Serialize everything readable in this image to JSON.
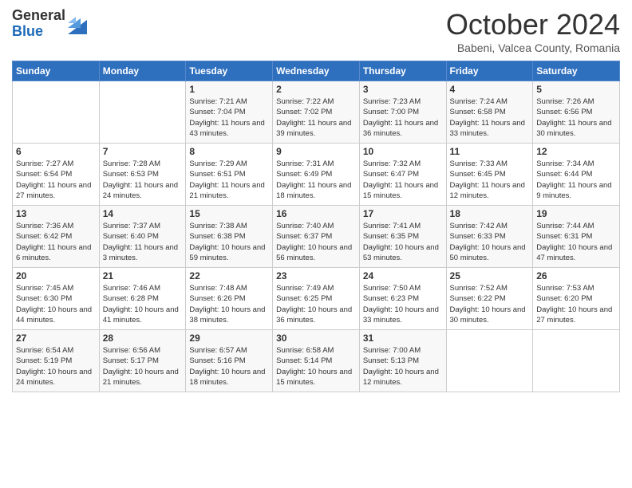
{
  "logo": {
    "general": "General",
    "blue": "Blue"
  },
  "title": "October 2024",
  "subtitle": "Babeni, Valcea County, Romania",
  "days_of_week": [
    "Sunday",
    "Monday",
    "Tuesday",
    "Wednesday",
    "Thursday",
    "Friday",
    "Saturday"
  ],
  "weeks": [
    [
      {
        "day": "",
        "info": ""
      },
      {
        "day": "",
        "info": ""
      },
      {
        "day": "1",
        "info": "Sunrise: 7:21 AM\nSunset: 7:04 PM\nDaylight: 11 hours and 43 minutes."
      },
      {
        "day": "2",
        "info": "Sunrise: 7:22 AM\nSunset: 7:02 PM\nDaylight: 11 hours and 39 minutes."
      },
      {
        "day": "3",
        "info": "Sunrise: 7:23 AM\nSunset: 7:00 PM\nDaylight: 11 hours and 36 minutes."
      },
      {
        "day": "4",
        "info": "Sunrise: 7:24 AM\nSunset: 6:58 PM\nDaylight: 11 hours and 33 minutes."
      },
      {
        "day": "5",
        "info": "Sunrise: 7:26 AM\nSunset: 6:56 PM\nDaylight: 11 hours and 30 minutes."
      }
    ],
    [
      {
        "day": "6",
        "info": "Sunrise: 7:27 AM\nSunset: 6:54 PM\nDaylight: 11 hours and 27 minutes."
      },
      {
        "day": "7",
        "info": "Sunrise: 7:28 AM\nSunset: 6:53 PM\nDaylight: 11 hours and 24 minutes."
      },
      {
        "day": "8",
        "info": "Sunrise: 7:29 AM\nSunset: 6:51 PM\nDaylight: 11 hours and 21 minutes."
      },
      {
        "day": "9",
        "info": "Sunrise: 7:31 AM\nSunset: 6:49 PM\nDaylight: 11 hours and 18 minutes."
      },
      {
        "day": "10",
        "info": "Sunrise: 7:32 AM\nSunset: 6:47 PM\nDaylight: 11 hours and 15 minutes."
      },
      {
        "day": "11",
        "info": "Sunrise: 7:33 AM\nSunset: 6:45 PM\nDaylight: 11 hours and 12 minutes."
      },
      {
        "day": "12",
        "info": "Sunrise: 7:34 AM\nSunset: 6:44 PM\nDaylight: 11 hours and 9 minutes."
      }
    ],
    [
      {
        "day": "13",
        "info": "Sunrise: 7:36 AM\nSunset: 6:42 PM\nDaylight: 11 hours and 6 minutes."
      },
      {
        "day": "14",
        "info": "Sunrise: 7:37 AM\nSunset: 6:40 PM\nDaylight: 11 hours and 3 minutes."
      },
      {
        "day": "15",
        "info": "Sunrise: 7:38 AM\nSunset: 6:38 PM\nDaylight: 10 hours and 59 minutes."
      },
      {
        "day": "16",
        "info": "Sunrise: 7:40 AM\nSunset: 6:37 PM\nDaylight: 10 hours and 56 minutes."
      },
      {
        "day": "17",
        "info": "Sunrise: 7:41 AM\nSunset: 6:35 PM\nDaylight: 10 hours and 53 minutes."
      },
      {
        "day": "18",
        "info": "Sunrise: 7:42 AM\nSunset: 6:33 PM\nDaylight: 10 hours and 50 minutes."
      },
      {
        "day": "19",
        "info": "Sunrise: 7:44 AM\nSunset: 6:31 PM\nDaylight: 10 hours and 47 minutes."
      }
    ],
    [
      {
        "day": "20",
        "info": "Sunrise: 7:45 AM\nSunset: 6:30 PM\nDaylight: 10 hours and 44 minutes."
      },
      {
        "day": "21",
        "info": "Sunrise: 7:46 AM\nSunset: 6:28 PM\nDaylight: 10 hours and 41 minutes."
      },
      {
        "day": "22",
        "info": "Sunrise: 7:48 AM\nSunset: 6:26 PM\nDaylight: 10 hours and 38 minutes."
      },
      {
        "day": "23",
        "info": "Sunrise: 7:49 AM\nSunset: 6:25 PM\nDaylight: 10 hours and 36 minutes."
      },
      {
        "day": "24",
        "info": "Sunrise: 7:50 AM\nSunset: 6:23 PM\nDaylight: 10 hours and 33 minutes."
      },
      {
        "day": "25",
        "info": "Sunrise: 7:52 AM\nSunset: 6:22 PM\nDaylight: 10 hours and 30 minutes."
      },
      {
        "day": "26",
        "info": "Sunrise: 7:53 AM\nSunset: 6:20 PM\nDaylight: 10 hours and 27 minutes."
      }
    ],
    [
      {
        "day": "27",
        "info": "Sunrise: 6:54 AM\nSunset: 5:19 PM\nDaylight: 10 hours and 24 minutes."
      },
      {
        "day": "28",
        "info": "Sunrise: 6:56 AM\nSunset: 5:17 PM\nDaylight: 10 hours and 21 minutes."
      },
      {
        "day": "29",
        "info": "Sunrise: 6:57 AM\nSunset: 5:16 PM\nDaylight: 10 hours and 18 minutes."
      },
      {
        "day": "30",
        "info": "Sunrise: 6:58 AM\nSunset: 5:14 PM\nDaylight: 10 hours and 15 minutes."
      },
      {
        "day": "31",
        "info": "Sunrise: 7:00 AM\nSunset: 5:13 PM\nDaylight: 10 hours and 12 minutes."
      },
      {
        "day": "",
        "info": ""
      },
      {
        "day": "",
        "info": ""
      }
    ]
  ]
}
